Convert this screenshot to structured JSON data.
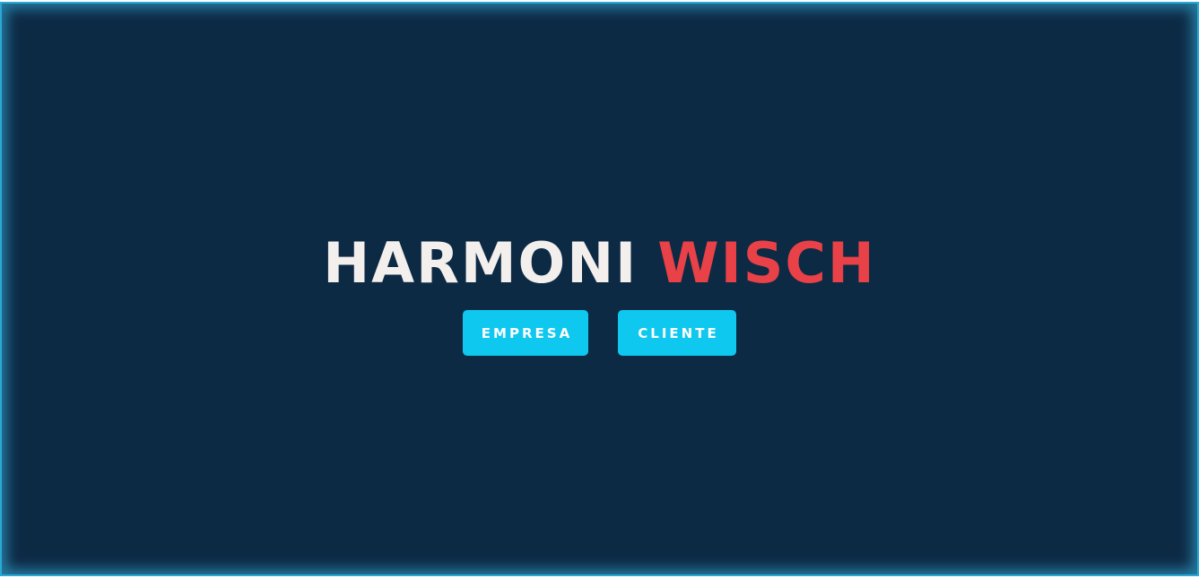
{
  "logo": {
    "word_1": "HARMONI",
    "word_2": "WISCH",
    "word_1_color": "#f3efed",
    "word_2_color": "#e84147"
  },
  "buttons": {
    "empresa_label": "EMPRESA",
    "cliente_label": "CLIENTE",
    "color": "#0ec8ef"
  },
  "theme": {
    "background": "#0d2a45",
    "glow": "#2aa8d8"
  }
}
